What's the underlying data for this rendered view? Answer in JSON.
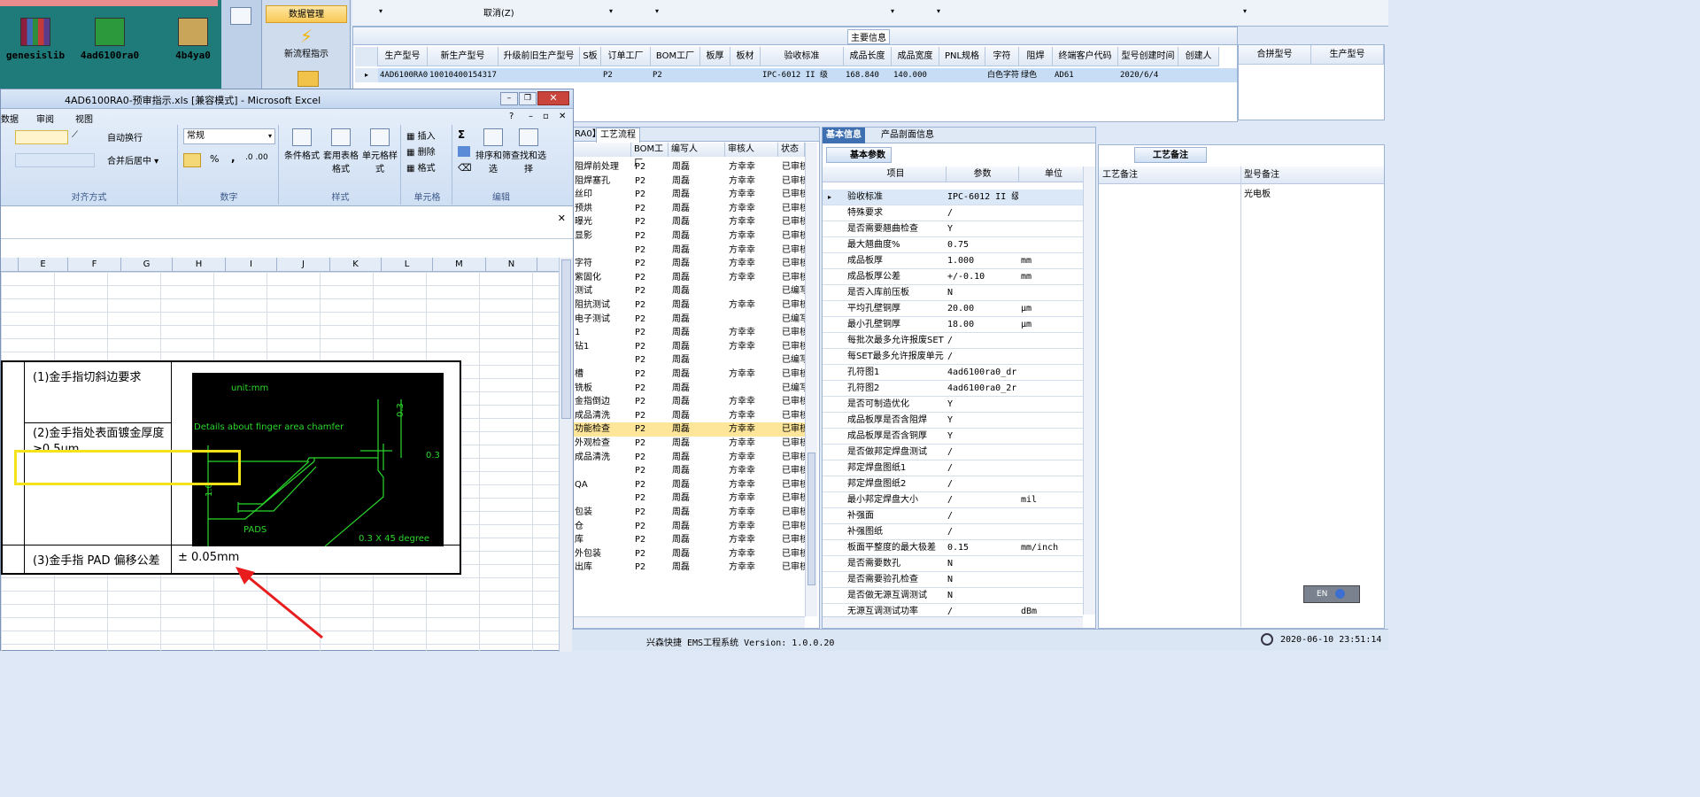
{
  "desktop": {
    "icons": [
      {
        "label": "genesislib"
      },
      {
        "label": "4ad6100ra0"
      },
      {
        "label": "4b4ya0"
      }
    ]
  },
  "nav": {
    "items": [
      {
        "label": "数据管理"
      },
      {
        "label": "新流程指示"
      }
    ]
  },
  "top_combo": {
    "cancel_label": "取消(Z)"
  },
  "main": {
    "section_title": "主要信息",
    "columns": [
      "生产型号",
      "新生产型号",
      "升级前旧生产型号",
      "S板",
      "订单工厂",
      "BOM工厂",
      "板厚",
      "板材",
      "验收标准",
      "成品长度",
      "成品宽度",
      "PNL规格",
      "字符",
      "阻焊",
      "终端客户代码",
      "型号创建时间",
      "创建人"
    ],
    "row": [
      "4AD6100RA0",
      "10010400154317",
      "",
      "",
      "P2",
      "P2",
      "",
      "",
      "IPC-6012 II 级",
      "168.840",
      "140.000",
      "",
      "白色字符",
      "绿色",
      "AD61",
      "2020/6/4",
      ""
    ],
    "merge_columns": [
      "合拼型号",
      "生产型号"
    ]
  },
  "excel": {
    "title": "4AD6100RA0-预审指示.xls [兼容模式] - Microsoft Excel",
    "tabs": [
      "数据",
      "审阅",
      "视图"
    ],
    "ribbon": {
      "wrap_text": "自动换行",
      "merge_center": "合并后居中",
      "align_group": "对齐方式",
      "number_format": "常规",
      "number_group": "数字",
      "cond_format": "条件格式",
      "table_format": "套用表格格式",
      "cell_style": "单元格样式",
      "style_group": "样式",
      "insert": "插入",
      "delete": "删除",
      "format": "格式",
      "cells_group": "单元格",
      "sort_filter": "排序和筛选",
      "find_select": "查找和选择",
      "edit_group": "编辑",
      "sigma": "Σ",
      "percent": "%",
      "comma": ","
    },
    "columns": [
      "E",
      "F",
      "G",
      "H",
      "I",
      "J",
      "K",
      "L",
      "M",
      "N"
    ],
    "table": {
      "row1": "(1)金手指切斜边要求",
      "row2": "(2)金手指处表面镀金厚度≥0.5um",
      "row3_label": "(3)金手指 PAD 偏移公差",
      "row3_value": "± 0.05mm"
    },
    "cad": {
      "unit": "unit:mm",
      "title": "Details about finger area chamfer",
      "dim1": "0.3",
      "dim2": "0.3",
      "dim3": "1.0",
      "pads": "PADS",
      "angle": "0.3 X 45 degree"
    }
  },
  "process": {
    "tab_prefix": "RA0】",
    "tab": "工艺流程",
    "columns": [
      "",
      "BOM工厂",
      "编写人",
      "审核人",
      "状态"
    ],
    "rows": [
      [
        "阻焊前处理",
        "P2",
        "周磊",
        "方幸幸",
        "已审核"
      ],
      [
        "阻焊塞孔",
        "P2",
        "周磊",
        "方幸幸",
        "已审核"
      ],
      [
        "丝印",
        "P2",
        "周磊",
        "方幸幸",
        "已审核"
      ],
      [
        "预烘",
        "P2",
        "周磊",
        "方幸幸",
        "已审核"
      ],
      [
        "曝光",
        "P2",
        "周磊",
        "方幸幸",
        "已审核"
      ],
      [
        "显影",
        "P2",
        "周磊",
        "方幸幸",
        "已审核"
      ],
      [
        "",
        "P2",
        "周磊",
        "方幸幸",
        "已审核"
      ],
      [
        "字符",
        "P2",
        "周磊",
        "方幸幸",
        "已审核"
      ],
      [
        "紫固化",
        "P2",
        "周磊",
        "方幸幸",
        "已审核"
      ],
      [
        "测试",
        "P2",
        "周磊",
        "",
        "已编写"
      ],
      [
        "阻抗测试",
        "P2",
        "周磊",
        "方幸幸",
        "已审核"
      ],
      [
        "电子测试",
        "P2",
        "周磊",
        "",
        "已编写"
      ],
      [
        "1",
        "P2",
        "周磊",
        "方幸幸",
        "已审核"
      ],
      [
        "钻1",
        "P2",
        "周磊",
        "方幸幸",
        "已审核"
      ],
      [
        "",
        "P2",
        "周磊",
        "",
        "已编写"
      ],
      [
        "槽",
        "P2",
        "周磊",
        "方幸幸",
        "已审核"
      ],
      [
        "铣板",
        "P2",
        "周磊",
        "",
        "已编写"
      ],
      [
        "金指倒边",
        "P2",
        "周磊",
        "方幸幸",
        "已审核"
      ],
      [
        "成品清洗",
        "P2",
        "周磊",
        "方幸幸",
        "已审核"
      ],
      [
        "功能检查",
        "P2",
        "周磊",
        "方幸幸",
        "已审核"
      ],
      [
        "外观检查",
        "P2",
        "周磊",
        "方幸幸",
        "已审核"
      ],
      [
        "成品清洗",
        "P2",
        "周磊",
        "方幸幸",
        "已审核"
      ],
      [
        "",
        "P2",
        "周磊",
        "方幸幸",
        "已审核"
      ],
      [
        "QA",
        "P2",
        "周磊",
        "方幸幸",
        "已审核"
      ],
      [
        "",
        "P2",
        "周磊",
        "方幸幸",
        "已审核"
      ],
      [
        "包装",
        "P2",
        "周磊",
        "方幸幸",
        "已审核"
      ],
      [
        "仓",
        "P2",
        "周磊",
        "方幸幸",
        "已审核"
      ],
      [
        "库",
        "P2",
        "周磊",
        "方幸幸",
        "已审核"
      ],
      [
        "外包装",
        "P2",
        "周磊",
        "方幸幸",
        "已审核"
      ],
      [
        "出库",
        "P2",
        "周磊",
        "方幸幸",
        "已审核"
      ]
    ]
  },
  "info": {
    "tabs": [
      "基本信息",
      "产品剖面信息"
    ],
    "subtab": "基本参数",
    "columns": [
      "项目",
      "参数",
      "单位"
    ],
    "rows": [
      [
        "验收标准",
        "IPC-6012 II 级",
        ""
      ],
      [
        "特殊要求",
        "/",
        ""
      ],
      [
        "是否需要翘曲检查",
        "Y",
        ""
      ],
      [
        "最大翘曲度%",
        "0.75",
        ""
      ],
      [
        "成品板厚",
        "1.000",
        "mm"
      ],
      [
        "成品板厚公差",
        "+/-0.10",
        "mm"
      ],
      [
        "是否入库前压板",
        "N",
        ""
      ],
      [
        "平均孔壁铜厚",
        "20.00",
        "μm"
      ],
      [
        "最小孔壁铜厚",
        "18.00",
        "μm"
      ],
      [
        "每批次最多允许报废SET",
        "/",
        ""
      ],
      [
        "每SET最多允许报废单元",
        "/",
        ""
      ],
      [
        "孔符图1",
        "4ad6100ra0_dr...",
        ""
      ],
      [
        "孔符图2",
        "4ad6100ra0_2r...",
        ""
      ],
      [
        "是否可制造优化",
        "Y",
        ""
      ],
      [
        "成品板厚是否含阻焊",
        "Y",
        ""
      ],
      [
        "成品板厚是否含铜厚",
        "Y",
        ""
      ],
      [
        "是否做邦定焊盘测试",
        "/",
        ""
      ],
      [
        "邦定焊盘图纸1",
        "/",
        ""
      ],
      [
        "邦定焊盘图纸2",
        "/",
        ""
      ],
      [
        "最小邦定焊盘大小",
        "/",
        "mil"
      ],
      [
        "补强面",
        "/",
        ""
      ],
      [
        "补强图纸",
        "/",
        ""
      ],
      [
        "板面平整度的最大极差",
        "0.15",
        "mm/inch"
      ],
      [
        "是否需要数孔",
        "N",
        ""
      ],
      [
        "是否需要验孔检查",
        "N",
        ""
      ],
      [
        "是否做无源互调测试",
        "N",
        ""
      ],
      [
        "无源互调测试功率",
        "/",
        "dBm"
      ]
    ]
  },
  "remarks": {
    "tab": "工艺备注",
    "col1": "工艺备注",
    "col2": "型号备注",
    "model_remark": "光电板"
  },
  "status": {
    "system": "兴森快捷 EMS工程系统 Version: 1.0.0.20",
    "datetime": "2020-06-10 23:51:14",
    "lang": "EN"
  },
  "colors": {
    "highlight": "#f5e31a",
    "arrow": "#e81c1c",
    "cad_lines": "#2bd82b",
    "selected_row": "#fde59a"
  }
}
